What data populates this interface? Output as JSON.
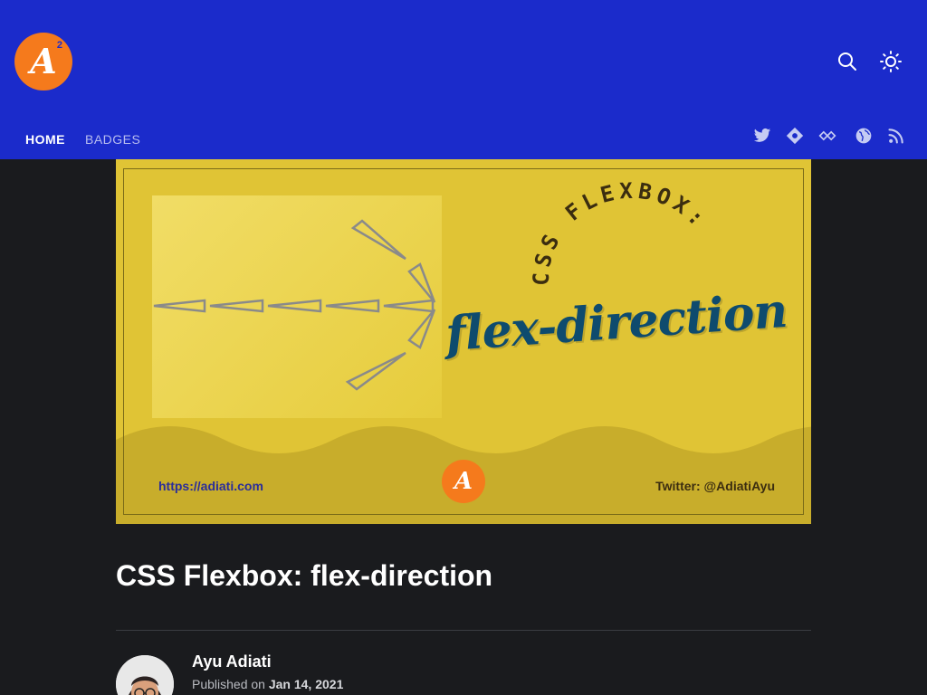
{
  "header": {
    "logo_letter": "A",
    "logo_sup": "2",
    "nav": [
      {
        "label": "HOME",
        "active": true
      },
      {
        "label": "BADGES",
        "active": false
      }
    ],
    "icons": [
      "search-icon",
      "sun-icon",
      "twitter-icon",
      "polywork-icon",
      "hashnode-icon",
      "globe-icon",
      "rss-icon"
    ],
    "colors": {
      "background": "#1b2bcb",
      "accent": "#f57a1c"
    }
  },
  "banner": {
    "arc_text": "CSS FLEXBOX:",
    "title": "flex-direction",
    "url": "https://adiati.com",
    "twitter": "Twitter: @AdiatiAyu",
    "logo_letter": "A",
    "colors": {
      "background": "#e0c435",
      "wave": "#c8ad2b",
      "title": "#0e4b6e"
    }
  },
  "post": {
    "title": "CSS Flexbox: flex-direction",
    "author": "Ayu Adiati",
    "published_prefix": "Published on",
    "published_date": "Jan 14, 2021"
  }
}
